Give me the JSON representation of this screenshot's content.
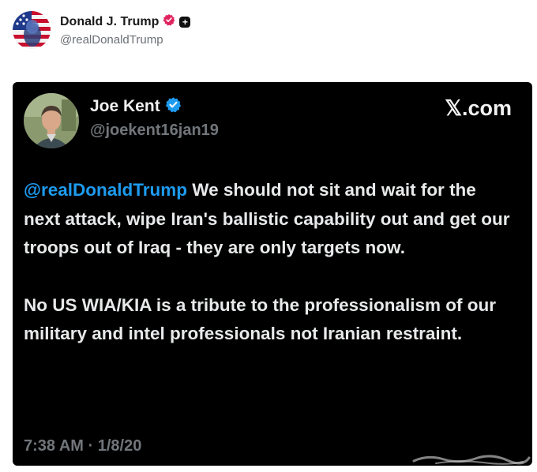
{
  "poster": {
    "name": "Donald J. Trump",
    "handle": "@realDonaldTrump",
    "icons": [
      "verified-badge-icon",
      "plus-badge-icon"
    ],
    "verified_color": "#e0245e"
  },
  "card": {
    "author_name": "Joe Kent",
    "author_handle": "@joekent16jan19",
    "site": "𝕏.com",
    "verified_color": "#1d9bf0",
    "mention": "@realDonaldTrump",
    "paragraph1_rest": " We should not sit and wait for the next attack, wipe Iran's ballistic capability out and get our troops out of Iraq - they are only targets now.",
    "paragraph2": "No US WIA/KIA is a tribute to the professionalism of our military and intel professionals not Iranian restraint.",
    "timestamp": "7:38 AM · 1/8/20"
  }
}
